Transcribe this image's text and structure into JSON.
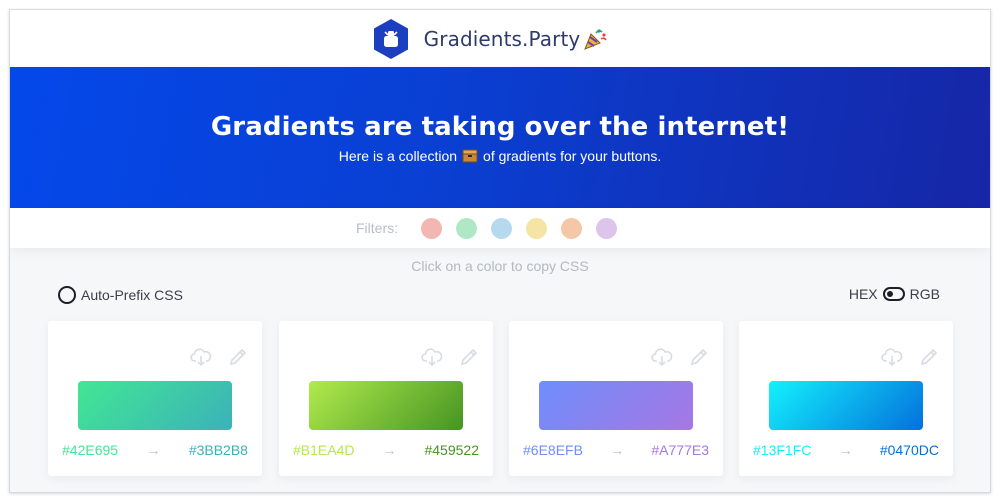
{
  "header": {
    "brand": "Gradients.Party"
  },
  "hero": {
    "title": "Gradients are taking over the internet!",
    "subtitle_before": "Here is a collection",
    "subtitle_after": "of gradients for your buttons."
  },
  "filters": {
    "label": "Filters:",
    "colors": [
      "#f2b6b3",
      "#b0e8c6",
      "#b7d9ee",
      "#f5e4a4",
      "#f4c8a6",
      "#dcc4ea"
    ]
  },
  "hint": "Click on a color to copy CSS",
  "options": {
    "autoprefix_label": "Auto-Prefix CSS",
    "hex_label": "HEX",
    "rgb_label": "RGB"
  },
  "arrow": "→",
  "cards": [
    {
      "from": "#42E695",
      "to": "#3BB2B8"
    },
    {
      "from": "#B1EA4D",
      "to": "#459522"
    },
    {
      "from": "#6E8EFB",
      "to": "#A777E3"
    },
    {
      "from": "#13F1FC",
      "to": "#0470DC"
    }
  ],
  "colors": {
    "hero_from": "#0448ea",
    "hero_to": "#1626a6",
    "brand_text": "#2d3a6b",
    "logo": "#1b3fbf"
  }
}
